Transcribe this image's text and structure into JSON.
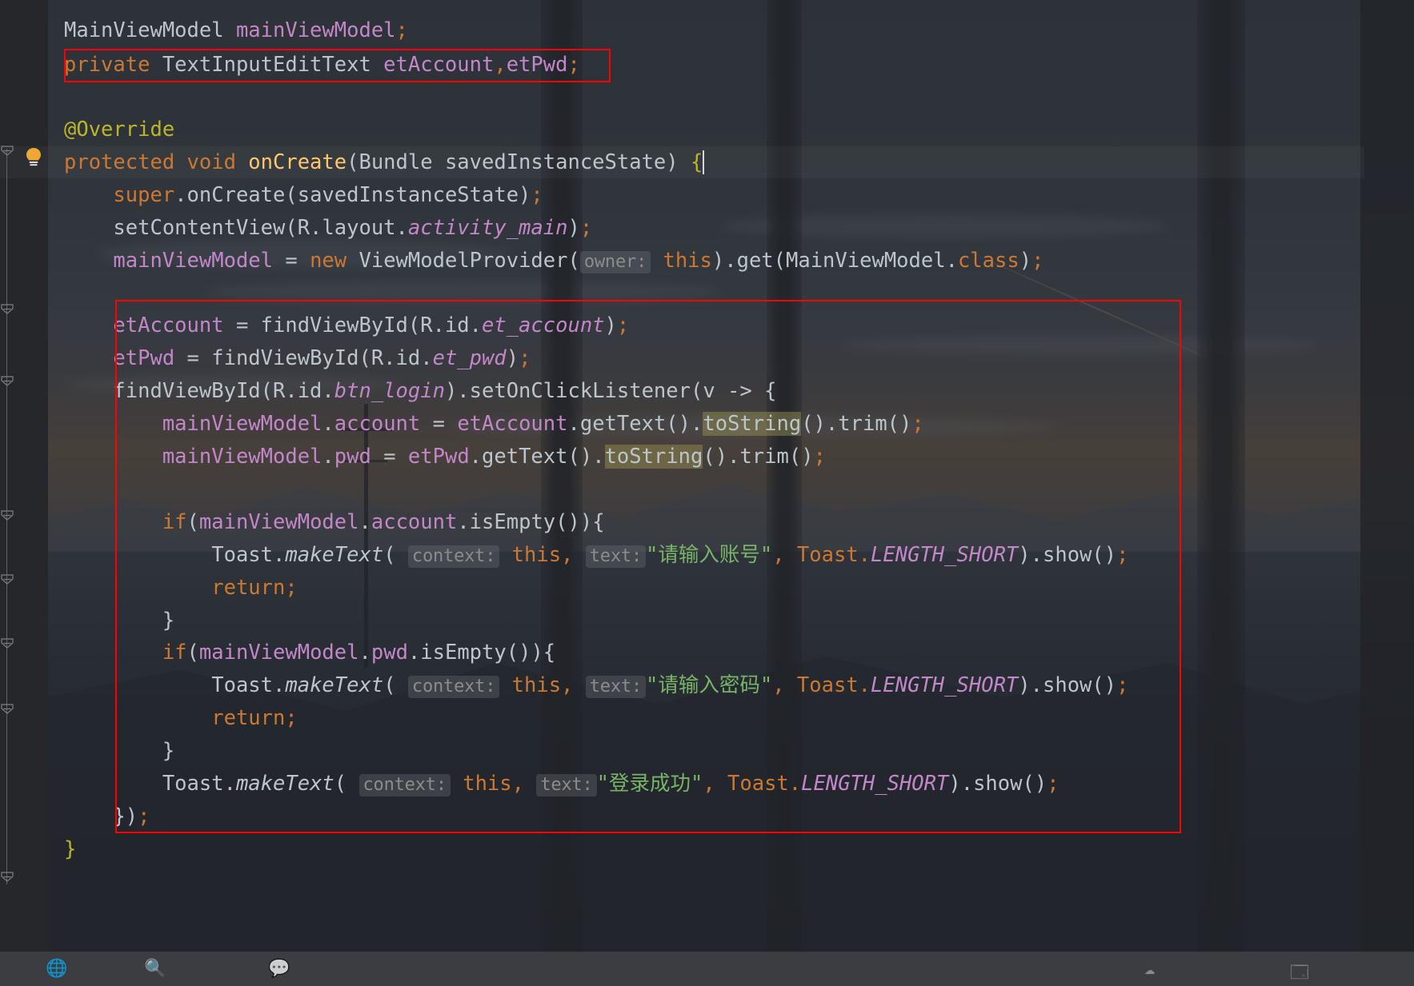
{
  "app": {
    "kind": "code-editor",
    "theme": "darcula-with-wallpaper",
    "background_description": "anime dusk landscape seen through window mullions"
  },
  "colors": {
    "editor_background": "#2b2b2b",
    "default_text": "#bcc4cc",
    "keyword": "#cc7832",
    "field": "#c387c9",
    "static_italic": "#c387c9",
    "method": "#ffc66d",
    "string": "#79b368",
    "annotation": "#bbb529",
    "parameter_hint": "#8c8c8c",
    "annotation_box": "#ff0000",
    "occurrence_highlight": "#9e9654",
    "taskbar": "#3b3d40"
  },
  "gutter": {
    "bulb_icon": "lightbulb-icon",
    "fold_markers": [
      "fold-marker-icon",
      "fold-marker-icon",
      "fold-marker-icon",
      "fold-marker-icon",
      "fold-marker-icon",
      "fold-marker-icon"
    ]
  },
  "annotations": {
    "box_1_label": "highlighted-declaration",
    "box_2_label": "highlighted-onclick-block"
  },
  "code": {
    "lines": [
      {
        "id": "line-1",
        "text": "MainViewModel mainViewModel;"
      },
      {
        "id": "line-2",
        "text": "private TextInputEditText etAccount,etPwd;"
      },
      {
        "id": "line-3",
        "text": ""
      },
      {
        "id": "line-4",
        "text": "@Override"
      },
      {
        "id": "line-5",
        "text": "protected void onCreate(Bundle savedInstanceState) {"
      },
      {
        "id": "line-6",
        "text": "    super.onCreate(savedInstanceState);"
      },
      {
        "id": "line-7",
        "text": "    setContentView(R.layout.activity_main);"
      },
      {
        "id": "line-8",
        "text": "    mainViewModel = new ViewModelProvider( owner: this).get(MainViewModel.class);"
      },
      {
        "id": "line-9",
        "text": ""
      },
      {
        "id": "line-10",
        "text": "    etAccount = findViewById(R.id.et_account);"
      },
      {
        "id": "line-11",
        "text": "    etPwd = findViewById(R.id.et_pwd);"
      },
      {
        "id": "line-12",
        "text": "    findViewById(R.id.btn_login).setOnClickListener(v -> {"
      },
      {
        "id": "line-13",
        "text": "        mainViewModel.account = etAccount.getText().toString().trim();"
      },
      {
        "id": "line-14",
        "text": "        mainViewModel.pwd = etPwd.getText().toString().trim();"
      },
      {
        "id": "line-15",
        "text": ""
      },
      {
        "id": "line-16",
        "text": "        if(mainViewModel.account.isEmpty()){"
      },
      {
        "id": "line-17",
        "text": "            Toast.makeText( context: this,  text: \"请输入账号\", Toast.LENGTH_SHORT).show();"
      },
      {
        "id": "line-18",
        "text": "            return;"
      },
      {
        "id": "line-19",
        "text": "        }"
      },
      {
        "id": "line-20",
        "text": "        if(mainViewModel.pwd.isEmpty()){"
      },
      {
        "id": "line-21",
        "text": "            Toast.makeText( context: this,  text: \"请输入密码\", Toast.LENGTH_SHORT).show();"
      },
      {
        "id": "line-22",
        "text": "            return;"
      },
      {
        "id": "line-23",
        "text": "        }"
      },
      {
        "id": "line-24",
        "text": "        Toast.makeText( context: this,  text: \"登录成功\", Toast.LENGTH_SHORT).show();"
      },
      {
        "id": "line-25",
        "text": "    });"
      },
      {
        "id": "line-26",
        "text": "}"
      }
    ],
    "tokens": {
      "l1_type": "MainViewModel ",
      "l1_field": "mainViewModel",
      "l1_semi": ";",
      "l2_kw": "private ",
      "l2_type": "TextInputEditText ",
      "l2_f1": "etAccount",
      "l2_comma": ",",
      "l2_f2": "etPwd",
      "l2_semi": ";",
      "l4_anno": "@Override",
      "l5_kw1": "protected ",
      "l5_kw2": "void ",
      "l5_m": "onCreate",
      "l5_rest": "(Bundle savedInstanceState) ",
      "l5_brace": "{",
      "l6_kw": "super",
      "l6_rest": ".onCreate(savedInstanceState)",
      "l6_semi": ";",
      "l7_a": "setContentView(R.layout.",
      "l7_static": "activity_main",
      "l7_b": ")",
      "l7_semi": ";",
      "l8_field": "mainViewModel",
      "l8_eq": " = ",
      "l8_kw": "new ",
      "l8_cls": "ViewModelProvider(",
      "l8_hint": "owner:",
      "l8_this": " this",
      "l8_mid": ").get(MainViewModel.",
      "l8_kw2": "class",
      "l8_end": ")",
      "l8_semi": ";",
      "l10_field": "etAccount",
      "l10_a": " = findViewById(R.id.",
      "l10_static": "et_account",
      "l10_b": ")",
      "l10_semi": ";",
      "l11_field": "etPwd",
      "l11_a": " = findViewById(R.id.",
      "l11_static": "et_pwd",
      "l11_b": ")",
      "l11_semi": ";",
      "l12_a": "findViewById(R.id.",
      "l12_static": "btn_login",
      "l12_b": ").setOnClickListener(v -> ",
      "l12_brace": "{",
      "l13_f1": "mainViewModel",
      "l13_dot": ".",
      "l13_f2": "account",
      "l13_eq": " = ",
      "l13_f3": "etAccount",
      "l13_m": ".getText().",
      "l13_hl": "toString",
      "l13_tail": "().trim()",
      "l13_semi": ";",
      "l14_f1": "mainViewModel",
      "l14_dot": ".",
      "l14_f2": "pwd",
      "l14_eq": " = ",
      "l14_f3": "etPwd",
      "l14_m": ".getText().",
      "l14_hl": "toString",
      "l14_tail": "().trim()",
      "l14_semi": ";",
      "l16_kw": "if",
      "l16_p1": "(",
      "l16_f1": "mainViewModel",
      "l16_dot": ".",
      "l16_f2": "account",
      "l16_rest": ".isEmpty()){",
      "l20_kw": "if",
      "l20_p1": "(",
      "l20_f1": "mainViewModel",
      "l20_dot": ".",
      "l20_f2": "pwd",
      "l20_rest": ".isEmpty()){",
      "toast_cls": "Toast.",
      "toast_m": "makeText",
      "toast_p": "( ",
      "hint_context": "context:",
      "toast_this": " this",
      "toast_comma": ", ",
      "hint_text": "text:",
      "str_account": "\"请输入账号\"",
      "str_pwd": "\"请输入密码\"",
      "str_success": "\"登录成功\"",
      "toast_mid": ", Toast.",
      "toast_const": "LENGTH_SHORT",
      "toast_tail": ").show()",
      "toast_semi": ";",
      "ret_kw": "return",
      "ret_semi": ";",
      "close_brace": "}",
      "l25_text": "})",
      "l25_semi": ";",
      "l26_brace": "}"
    }
  },
  "taskbar": {
    "icons": [
      "browser-icon",
      "search-icon",
      "chat-icon",
      "cloud-icon",
      "window-icon"
    ]
  }
}
